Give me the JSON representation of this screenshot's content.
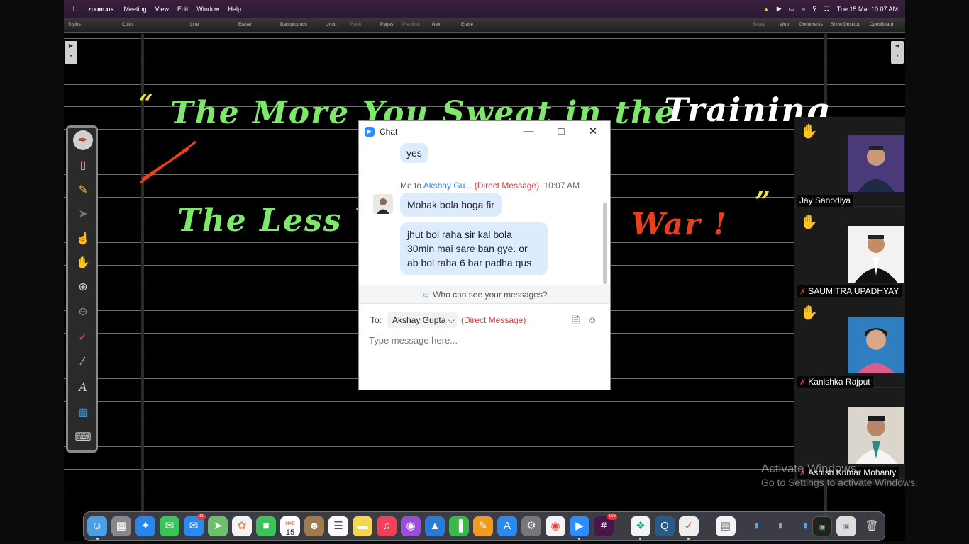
{
  "menubar": {
    "app_name": "zoom.us",
    "menus": [
      "Meeting",
      "View",
      "Edit",
      "Window",
      "Help"
    ],
    "clock": "Tue 15 Mar  10:07 AM"
  },
  "openboard_toolbar": {
    "left_items": [
      "Stylus",
      "Color",
      "Line",
      "Eraser",
      "Backgrounds",
      "Undo",
      "Redo",
      "Pages",
      "Previous",
      "Next",
      "Erase"
    ],
    "right_items": [
      "Board",
      "Web",
      "Documents",
      "Show Desktop",
      "OpenBoard"
    ]
  },
  "board": {
    "line1_quote_open": "“",
    "line1_text": "The More You Sweat in the",
    "line1_word_white": "Training",
    "line2_text": "The Less You",
    "line2_word_red": "War !",
    "line2_quote_close": "”",
    "colors": {
      "green": "#7de86a",
      "yellow": "#f0e040",
      "red": "#e8401c",
      "white": "#ffffff"
    }
  },
  "tools": [
    "pen-icon",
    "eraser-icon",
    "marker-icon",
    "selector-icon",
    "interact-icon",
    "hand-icon",
    "zoom-in-icon",
    "zoom-out-icon",
    "laser-pointer-icon",
    "line-icon",
    "text-icon",
    "capture-icon",
    "keyboard-icon"
  ],
  "chat": {
    "title": "Chat",
    "prev_message": "yes",
    "meta_prefix": "Me to ",
    "meta_recipient": "Akshay Gu...",
    "meta_dm": "(Direct Message)",
    "meta_time": "10:07 AM",
    "messages": [
      "Mohak bola hoga fir",
      "jhut bol raha sir kal bola 30min mai sare ban gye. or ab bol raha 6 bar padha qus"
    ],
    "who_can_see": "Who can see your messages?",
    "to_label": "To:",
    "to_value": "Akshay Gupta",
    "to_dm": "(Direct Message)",
    "input_placeholder": "Type message here..."
  },
  "participants": [
    {
      "name": "Jay Sanodiya",
      "muted": false
    },
    {
      "name": "SAUMITRA UPADHYAY",
      "muted": true
    },
    {
      "name": "Kanishka Rajput",
      "muted": true
    },
    {
      "name": "Ashish Kumar Mohanty",
      "muted": true
    }
  ],
  "dock": {
    "calendar_month": "MAR",
    "calendar_day": "15",
    "mail_badge": "11",
    "slack_badge": "106"
  },
  "watermark": {
    "line1": "Activate Windows",
    "line2": "Go to Settings to activate Windows."
  }
}
